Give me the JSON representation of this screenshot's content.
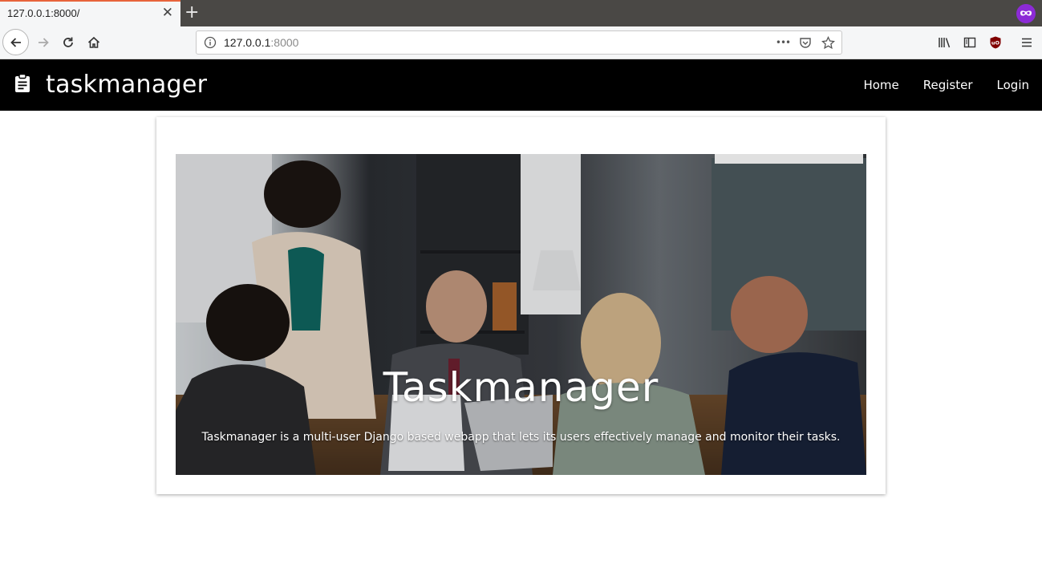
{
  "browser": {
    "tab_title": "127.0.0.1:8000/",
    "tab_close": "✕",
    "new_tab": "+",
    "url_host": "127.0.0.1",
    "url_port": ":8000",
    "url_more": "•••"
  },
  "site": {
    "brand": "taskmanager",
    "nav": [
      "Home",
      "Register",
      "Login"
    ]
  },
  "hero": {
    "title": "Taskmanager",
    "description": "Taskmanager is a multi-user Django based webapp that lets its users effectively manage and monitor their tasks."
  },
  "colors": {
    "navbar_bg": "#000000",
    "tab_accent": "#e8643c",
    "private_badge": "#8c2bd6",
    "ublock_badge": "#800000"
  },
  "icons": {
    "brand": "clipboard-icon",
    "private": "private-browsing-mask-icon",
    "toolbar": [
      "back-icon",
      "forward-icon",
      "reload-icon",
      "home-icon",
      "site-info-icon",
      "page-actions-icon",
      "pocket-icon",
      "bookmark-star-icon",
      "library-icon",
      "sidebar-icon",
      "ublock-icon",
      "menu-icon"
    ]
  }
}
